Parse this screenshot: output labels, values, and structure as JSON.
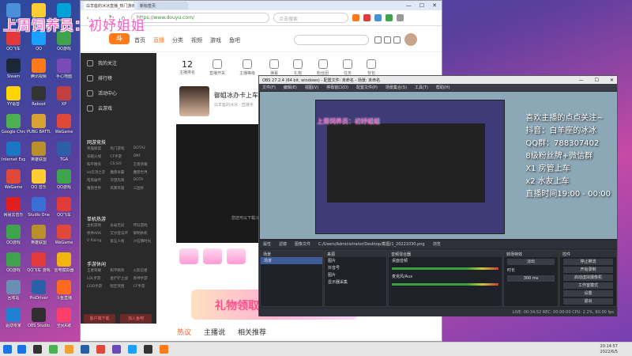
{
  "overlay": {
    "title": "上周饲养员：初妤姐姐"
  },
  "desktop": {
    "icons": [
      {
        "label": "此电脑",
        "color": "#4a90d9"
      },
      {
        "label": "QQ音乐",
        "color": "#ffcc33"
      },
      {
        "label": "哔哩哔哩",
        "color": "#00a1d6"
      },
      {
        "label": "QQ飞车",
        "color": "#e23a3a"
      },
      {
        "label": "QQ",
        "color": "#1aa0ff"
      },
      {
        "label": "QQ游戏",
        "color": "#3fa34d"
      },
      {
        "label": "Steam",
        "color": "#1b2838"
      },
      {
        "label": "腾讯视频",
        "color": "#ff7a1a"
      },
      {
        "label": "手心地面",
        "color": "#7a4ab5"
      },
      {
        "label": "YY语音",
        "color": "#ffd400"
      },
      {
        "label": "Reboot",
        "color": "#333333"
      },
      {
        "label": "XP",
        "color": "#c04040"
      },
      {
        "label": "Google Chrome",
        "color": "#4caf50"
      },
      {
        "label": "PUBG BATTLEG...",
        "color": "#d7a233"
      },
      {
        "label": "WeGame",
        "color": "#e0493a"
      },
      {
        "label": "Internet Explorer",
        "color": "#1c77c3"
      },
      {
        "label": "英雄联盟",
        "color": "#b8902a"
      },
      {
        "label": "TGA",
        "color": "#2c5fa8"
      },
      {
        "label": "WeGame",
        "color": "#e0493a"
      },
      {
        "label": "QQ 音乐",
        "color": "#ffcc33"
      },
      {
        "label": "QQ游戏",
        "color": "#3fa34d"
      },
      {
        "label": "网易云音乐",
        "color": "#e02020"
      },
      {
        "label": "Studio One",
        "color": "#3a6fd8"
      },
      {
        "label": "QQ飞车",
        "color": "#e23a3a"
      },
      {
        "label": "QQ游戏",
        "color": "#3fa34d"
      },
      {
        "label": "英雄联盟",
        "color": "#b8902a"
      },
      {
        "label": "WeGame",
        "color": "#e0493a"
      },
      {
        "label": "QQ游戏",
        "color": "#3fa34d"
      },
      {
        "label": "QQ飞车 游戏",
        "color": "#e23a3a"
      },
      {
        "label": "雷电模拟器",
        "color": "#f2b40f"
      },
      {
        "label": "回收站",
        "color": "#6b8fb3"
      },
      {
        "label": "ProDriver",
        "color": "#2b5fa8"
      },
      {
        "label": "斗鱼直播",
        "color": "#ff6a1f"
      },
      {
        "label": "驱动专家",
        "color": "#1f7fd1"
      },
      {
        "label": "OBS Studio",
        "color": "#302e31"
      },
      {
        "label": "全民K歌",
        "color": "#ff3f6b"
      }
    ]
  },
  "browser": {
    "tabs": [
      "白羊座的冰冰直播_热门游戏直播",
      "新标签页"
    ],
    "url": "https://www.douyu.com/",
    "search_placeholder": "点击搜索",
    "nav": [
      "首页",
      "直播",
      "分类",
      "视频",
      "游戏",
      "鱼吧"
    ],
    "nav_active": 1,
    "sidebar": {
      "items": [
        "我的关注",
        "排行榜",
        "活动中心",
        "云游戏"
      ],
      "section_hot": "网游竞技",
      "hot_games": [
        "英雄联盟",
        "热门游戏",
        "DOTA2",
        "穿越火线",
        "CF手游",
        "DNF",
        "和平精英",
        "CS:GO",
        "王者荣耀",
        "lol云顶之弈",
        "魔兽争霸",
        "魔兽世界",
        "暗黑破坏",
        "守望先锋",
        "DOTA",
        "魔兽世界",
        "风暴英雄",
        "三国杀"
      ],
      "section_mobile": "单机热游",
      "mobile_games": [
        "主机游戏",
        "永劫无间",
        "怀旧游戏",
        "原神ARK",
        "艾尔登法环",
        "黎明杀机",
        "V Rising",
        "第五人格",
        "沙石镇时光"
      ],
      "section_phone": "手游休闲",
      "phone_games": [
        "王者荣耀",
        "和平精英",
        "火影忍者",
        "LOL手游",
        "金铲铲之战",
        "原神手游",
        "COD手游",
        "暗区突围",
        "CF手游"
      ],
      "btn_left": "客户端下载",
      "btn_right": "加入鱼吧"
    },
    "stats": [
      {
        "value": "12",
        "label": "主播排名"
      },
      {
        "value": "",
        "label": "直播开关"
      },
      {
        "value": "",
        "label": "主播等级"
      },
      {
        "value": "",
        "label": "弹幕"
      },
      {
        "value": "",
        "label": "礼物"
      },
      {
        "value": "",
        "label": "粉丝团"
      },
      {
        "value": "",
        "label": "任务"
      },
      {
        "value": "",
        "label": "背包"
      }
    ],
    "streamer": {
      "name": "御姐冰办卡上车",
      "sub": "白羊座的冰冰 · 直播中"
    },
    "player_message": "您还可以下载斗鱼客户端观看直播",
    "banner": "礼物领取福",
    "bottom_tabs": [
      "热议",
      "主播说",
      "相关推荐"
    ]
  },
  "obs": {
    "title": "OBS 27.2.4 (64 bit, windows) - 配置文件: 未命名 - 场景: 未命名",
    "menu": [
      "文件(F)",
      "编辑(E)",
      "视图(V)",
      "停靠窗口(D)",
      "配置文件(P)",
      "场景集合(S)",
      "工具(T)",
      "帮助(H)"
    ],
    "overlay_lines": [
      "喜欢主播的点点关注~",
      "抖音：白羊座的冰冰",
      "QQ群：788307402",
      "8级粉丝牌+微信群",
      "X1 房管上车",
      "x2 水友上车",
      "直播时间19:00 - 00:00"
    ],
    "toolbar": [
      "属性",
      "滤镜",
      "图像文件",
      "C:/Users/Administrator/Desktop/截图/1_20221030.png",
      "浏览"
    ],
    "docks": {
      "scenes_title": "场景",
      "scenes": [
        "场景"
      ],
      "sources_title": "来源",
      "sources": [
        "图片",
        "抖音号",
        "图片",
        "显示器采集"
      ],
      "mixer_title": "音频混合器",
      "mixer": [
        {
          "name": "桌面音频",
          "level": "0.0 dB"
        },
        {
          "name": "麦克风/Aux",
          "level": "0.0 dB"
        }
      ],
      "transitions_title": "转场特效",
      "transition_type": "淡出",
      "duration_label": "时长",
      "duration_value": "300 ms",
      "controls_title": "控件",
      "controls": [
        "停止推流",
        "开始录制",
        "启动虚拟摄像机",
        "工作室模式",
        "设置",
        "退出"
      ]
    },
    "status": "LIVE: 00:34:52   REC: 00:00:00   CPU: 2.2%, 60.00 fps"
  },
  "taskbar": {
    "apps": [
      "#1a73e8",
      "#333333",
      "#4caf50",
      "#f0a030",
      "#2a5fa8",
      "#e0493a",
      "#6b4ab5",
      "#1aa0ff",
      "#333333",
      "#ff7a1a"
    ],
    "time": "20:14:57",
    "date": "2022/6/5"
  }
}
